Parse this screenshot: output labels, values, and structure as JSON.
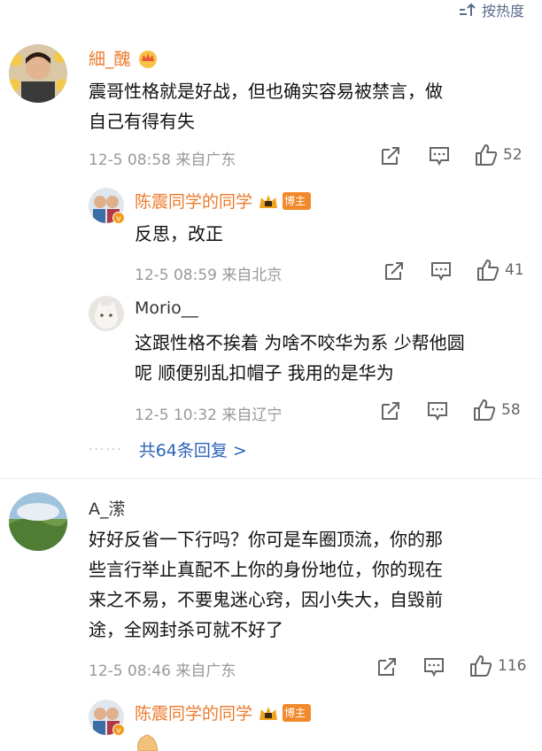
{
  "sort_label": "按热度",
  "comments": [
    {
      "user": "細_醜",
      "text_line1": "震哥性格就是好战，但也确实容易被禁言，做",
      "text_line2": "自己有得有失",
      "meta": "12-5 08:58 来自广东",
      "likes": "52"
    },
    {
      "user": "陈震同学的同学",
      "badge": "博主",
      "text_line1": "反思，改正",
      "meta": "12-5 08:59 来自北京",
      "likes": "41"
    },
    {
      "user": "Morio__",
      "text_line1": "这跟性格不挨着 为啥不咬华为系 少帮他圆",
      "text_line2": "呢 顺便别乱扣帽子 我用的是华为",
      "meta": "12-5 10:32 来自辽宁",
      "likes": "58"
    },
    {
      "user": "A_潆",
      "text_line1": "好好反省一下行吗？你可是车圈顶流，你的那",
      "text_line2": "些言行举止真配不上你的身份地位，你的现在",
      "text_line3": "来之不易，不要鬼迷心窍，因小失大，自毁前",
      "text_line4": "途，全网封杀可就不好了",
      "meta": "12-5 08:46 来自广东",
      "likes": "116"
    },
    {
      "user": "陈震同学的同学",
      "badge": "博主"
    }
  ],
  "replies_dots": "······",
  "replies_label": "共64条回复 >"
}
